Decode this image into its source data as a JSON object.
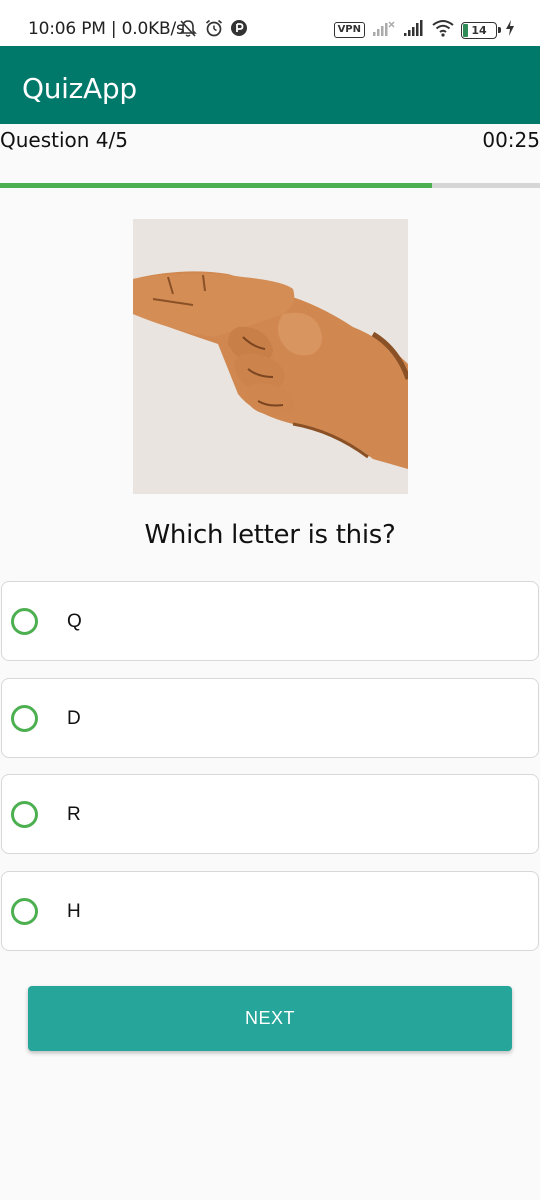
{
  "status_bar": {
    "time_text": "10:06 PM | 0.0KB/s",
    "vpn_label": "VPN",
    "battery_level": "14",
    "icons": [
      "bell-off-icon",
      "alarm-icon",
      "app-notification-icon",
      "signal-nosim-icon",
      "signal-icon",
      "wifi-icon",
      "battery-icon",
      "charging-bolt-icon"
    ]
  },
  "app_bar": {
    "title": "QuizApp",
    "color": "#00796b"
  },
  "quiz": {
    "counter": "Question 4/5",
    "timer": "00:25",
    "progress_fraction": 0.8,
    "question": "Which letter is this?",
    "image_icon": "hand-sign-icon",
    "options": [
      {
        "label": "Q"
      },
      {
        "label": "D"
      },
      {
        "label": "R"
      },
      {
        "label": "H"
      }
    ],
    "next_label": "NEXT"
  },
  "colors": {
    "accent": "#26a69a",
    "progress": "#4caf50",
    "radio": "#4caf50"
  }
}
